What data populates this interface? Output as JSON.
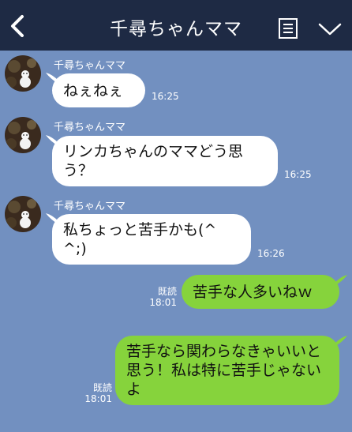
{
  "header": {
    "title": "千尋ちゃんママ",
    "back_icon": "chevron-left-icon",
    "note_icon": "note-icon",
    "menu_icon": "chevron-down-icon",
    "bg_color": "#1e2a44"
  },
  "chat": {
    "bg_color": "#7290c0",
    "incoming_bubble_color": "#ffffff",
    "outgoing_bubble_color": "#86d33c",
    "messages": [
      {
        "sender": "千尋ちゃんママ",
        "text": "ねぇねぇ",
        "time": "16:25"
      },
      {
        "sender": "千尋ちゃんママ",
        "text": "リンカちゃんのママどう思う？",
        "time": "16:25"
      },
      {
        "sender": "千尋ちゃんママ",
        "text": "私ちょっと苦手かも(^^;)",
        "time": "16:26"
      },
      {
        "read": "既読",
        "text": "苦手な人多いねｗ",
        "time": "18:01"
      },
      {
        "read": "既読",
        "text": "苦手なら関わらなきゃいいと思う！私は特に苦手じゃないよ",
        "time": "18:01"
      }
    ]
  }
}
